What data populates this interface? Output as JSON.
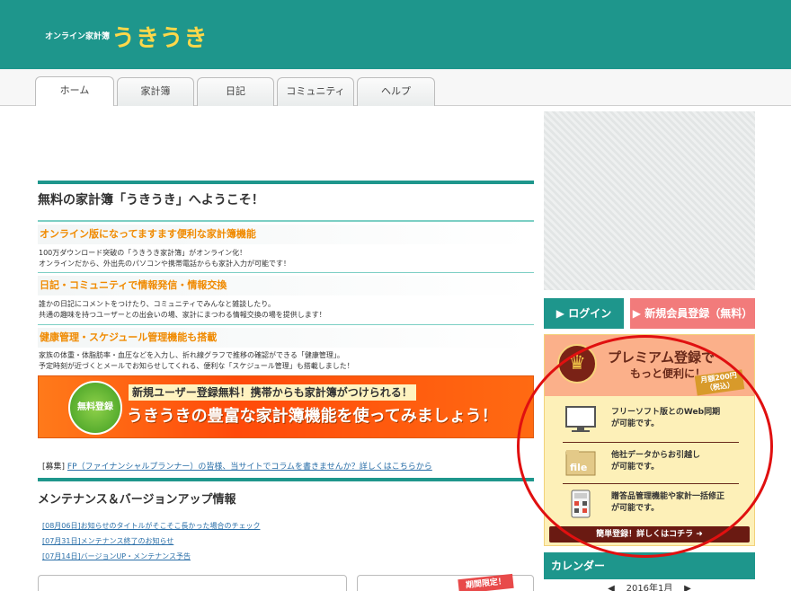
{
  "header": {
    "brand_small": "オンライン家計簿",
    "brand_big": "うきうき"
  },
  "tabs": [
    {
      "label": "ホーム"
    },
    {
      "label": "家計簿"
    },
    {
      "label": "日記"
    },
    {
      "label": "コミュニティ"
    },
    {
      "label": "ヘルプ"
    }
  ],
  "main": {
    "welcome": "無料の家計簿「うきうき」へようこそ！",
    "features": [
      {
        "title": "オンライン版になってますます便利な家計簿機能",
        "text1": "100万ダウンロード突破の「うきうき家計簿」がオンライン化！",
        "text2": "オンラインだから、外出先のパソコンや携帯電話からも家計入力が可能です！"
      },
      {
        "title": "日記・コミュニティで情報発信・情報交換",
        "text1": "誰かの日記にコメントをつけたり、コミュニティでみんなと雑談したり。",
        "text2": "共通の趣味を持つユーザーとの出会いの場、家計にまつわる情報交換の場を提供します！"
      },
      {
        "title": "健康管理・スケジュール管理機能も搭載",
        "text1": "家族の体重・体脂肪率・血圧などを入力し、折れ線グラフで推移の確認ができる「健康管理」。",
        "text2": "予定時刻が近づくとメールでお知らせしてくれる、便利な「スケジュール管理」も搭載しました！"
      }
    ],
    "banner": {
      "badge": "無料登録",
      "line1": "新規ユーザー登録無料！携帯からも家計簿がつけられる！",
      "line2": "うきうきの豊富な家計簿機能を使ってみましょう！"
    },
    "recruit": {
      "prefix": "[募集]",
      "link": "FP（ファイナンシャルプランナー）の皆様、当サイトでコラムを書きませんか？詳しくはこちらから"
    },
    "maintenance_title": "メンテナンス＆バージョンアップ情報",
    "news": [
      "[08月06日]お知らせのタイトルがそこそこ長かった場合のチェック",
      "[07月31日]メンテナンス終了のお知らせ",
      "[07月14日]バージョンUP・メンテナンス予告"
    ],
    "limited_badge": "期間限定！"
  },
  "sidebar": {
    "login_label": "▶ ログイン",
    "register_label": "▶ 新規会員登録（無料）",
    "premium": {
      "title": "プレミアム登録で",
      "subtitle": "もっと便利に！",
      "price_line1": "月額200円",
      "price_line2": "（税込）",
      "features": [
        {
          "line1": "フリーソフト版とのWeb同期",
          "line2": "が可能です。",
          "icon": "monitor-icon"
        },
        {
          "line1": "他社データからお引越し",
          "line2": "が可能です。",
          "icon": "file-icon"
        },
        {
          "line1": "贈答品管理機能や家計一括修正",
          "line2": "が可能です。",
          "icon": "calculator-icon"
        }
      ],
      "cta": "簡単登録！詳しくはコチラ ➜"
    },
    "calendar": {
      "title": "カレンダー",
      "prev": "◀",
      "month": "2016年1月",
      "next": "▶"
    }
  },
  "colors": {
    "brand_teal": "#1e968c",
    "accent_yellow": "#ffd84a",
    "feature_orange": "#f08a00",
    "register_pink": "#f27b7b",
    "annotation_red": "#e01010"
  }
}
